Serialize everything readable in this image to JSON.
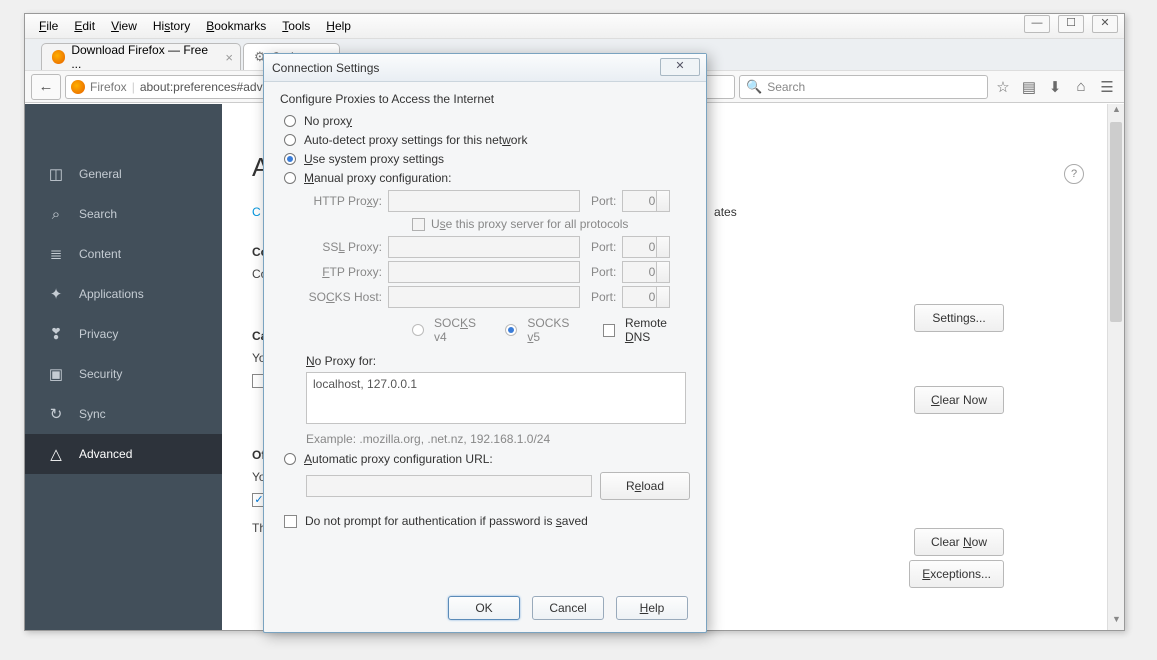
{
  "menubar": [
    "File",
    "Edit",
    "View",
    "History",
    "Bookmarks",
    "Tools",
    "Help"
  ],
  "menubar_accel": [
    "F",
    "E",
    "V",
    "Hi",
    "B",
    "T",
    "He"
  ],
  "tabs": [
    {
      "label": "Download Firefox — Free ...",
      "active": false
    },
    {
      "label": "Options",
      "active": true
    }
  ],
  "url": {
    "brand": "Firefox",
    "path": "about:preferences#advanced"
  },
  "search_placeholder": "Search",
  "sidebar": [
    {
      "icon": "◫",
      "label": "General"
    },
    {
      "icon": "⌕",
      "label": "Search"
    },
    {
      "icon": "≣",
      "label": "Content"
    },
    {
      "icon": "✦",
      "label": "Applications"
    },
    {
      "icon": "❣",
      "label": "Privacy"
    },
    {
      "icon": "▣",
      "label": "Security"
    },
    {
      "icon": "↻",
      "label": "Sync"
    },
    {
      "icon": "△",
      "label": "Advanced",
      "active": true
    }
  ],
  "page_title_visible": "Ad",
  "sub_tab_visible": "C",
  "sub_tab_right": "ates",
  "sections": {
    "connection": {
      "h": "Cor",
      "t": "Cor",
      "btn": "Settings..."
    },
    "cache": {
      "h": "Cac",
      "t": "You",
      "btn": "Clear Now"
    },
    "offline": {
      "h": "Off",
      "t": "You",
      "t2": "The",
      "btn1": "Clear Now",
      "btn2": "Exceptions..."
    }
  },
  "dialog": {
    "title": "Connection Settings",
    "heading": "Configure Proxies to Access the Internet",
    "radios": {
      "no_proxy": "No proxy",
      "auto_detect": "Auto-detect proxy settings for this network",
      "system": "Use system proxy settings",
      "manual": "Manual proxy configuration:",
      "auto_url": "Automatic proxy configuration URL:"
    },
    "selected_radio": "system",
    "fields": {
      "http": {
        "label": "HTTP Proxy:",
        "port_label": "Port:",
        "port": "0"
      },
      "ssl": {
        "label": "SSL Proxy:",
        "port_label": "Port:",
        "port": "0"
      },
      "ftp": {
        "label": "FTP Proxy:",
        "port_label": "Port:",
        "port": "0"
      },
      "socks": {
        "label": "SOCKS Host:",
        "port_label": "Port:",
        "port": "0"
      }
    },
    "use_all": "Use this proxy server for all protocols",
    "socks_v4": "SOCKS v4",
    "socks_v5": "SOCKS v5",
    "socks_selected": "v5",
    "remote_dns": "Remote DNS",
    "no_proxy_for_label": "No Proxy for:",
    "no_proxy_for_value": "localhost, 127.0.0.1",
    "example": "Example: .mozilla.org, .net.nz, 192.168.1.0/24",
    "reload": "Reload",
    "no_prompt": "Do not prompt for authentication if password is saved",
    "buttons": {
      "ok": "OK",
      "cancel": "Cancel",
      "help": "Help"
    }
  }
}
